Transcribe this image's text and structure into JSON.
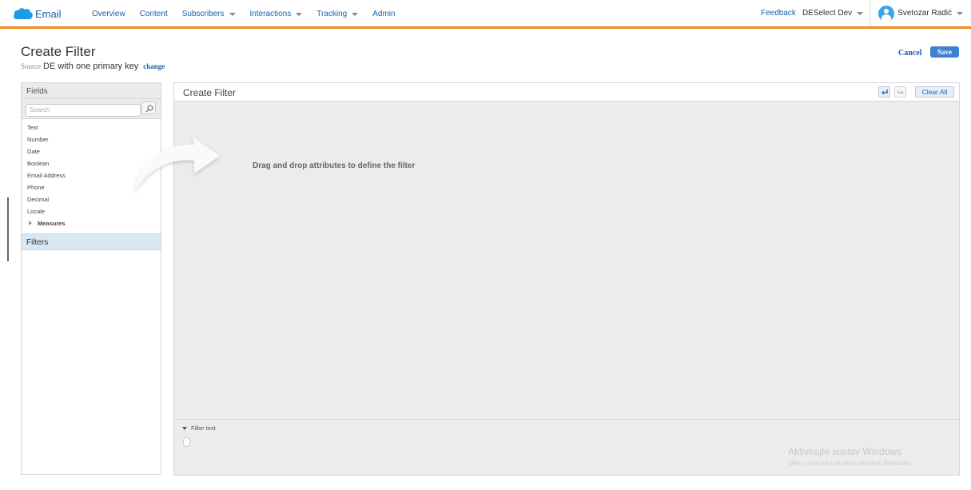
{
  "topbar": {
    "app_name": "Email",
    "nav_items": [
      "Overview",
      "Content",
      "Subscribers",
      "Interactions",
      "Tracking",
      "Admin"
    ],
    "feedback": "Feedback",
    "business_unit": "DESelect Dev",
    "user_name": "Svetozar Radić",
    "accent_color": "#f28c1e"
  },
  "page": {
    "title": "Create Filter",
    "source_label": "Source",
    "source_name": "DE with one primary key",
    "change_label": "change",
    "cancel_label": "Cancel",
    "save_label": "Save"
  },
  "fields": {
    "header": "Fields",
    "search_placeholder": "Search",
    "items": [
      "Text",
      "Number",
      "Date",
      "Boolean",
      "Email Address",
      "Phone",
      "Decimal",
      "Locale"
    ],
    "group": "Measures",
    "filters_header": "Filters"
  },
  "main": {
    "title": "Create Filter",
    "clear_all": "Clear All",
    "drop_hint": "Drag and drop attributes to define the filter",
    "filter_text_toggle": "Filter text"
  },
  "watermark": {
    "title": "Aktivirajte sustav Windows",
    "subtitle": "Idite u postavke da biste aktivirali Windows."
  }
}
